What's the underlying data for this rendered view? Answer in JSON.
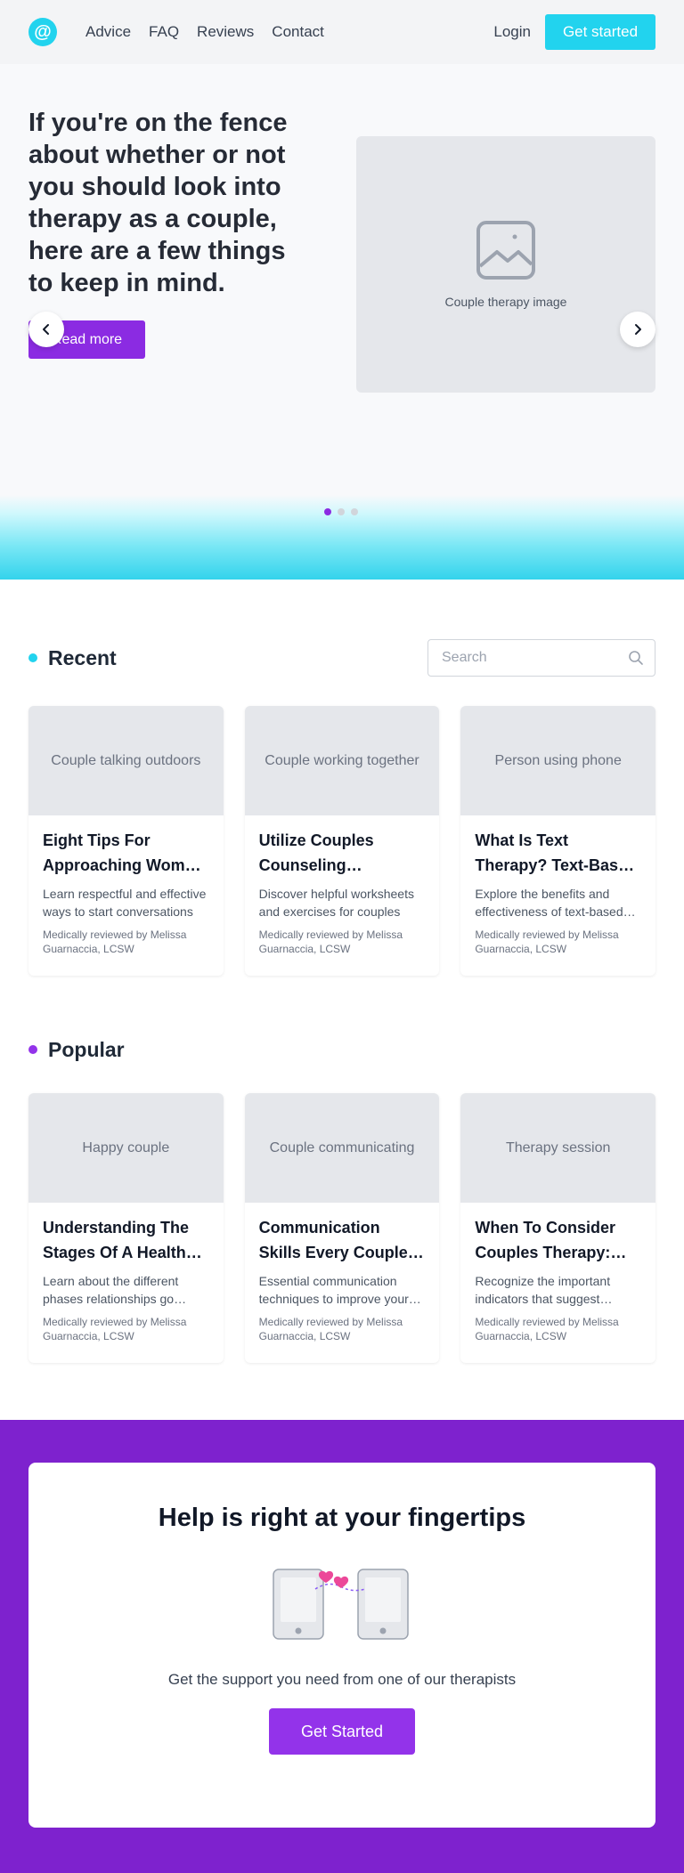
{
  "nav": {
    "logo_glyph": "@",
    "links": [
      "Advice",
      "FAQ",
      "Reviews",
      "Contact"
    ],
    "login_label": "Login",
    "cta_label": "Get started"
  },
  "hero": {
    "headline": "If you're on the fence about whether or not you should look into therapy as a couple, here are a few things to keep in mind.",
    "button_label": "Read more",
    "image_label": "Couple therapy image",
    "slides_total": 3,
    "active_slide": 1
  },
  "recent": {
    "title": "Recent",
    "accent": "#22d3ee",
    "search_placeholder": "Search",
    "cards": [
      {
        "image_label": "Couple talking outdoors",
        "title": "Eight Tips For Approaching Women Respectfully",
        "description": "Learn respectful and effective ways to start conversations",
        "reviewer": "Medically reviewed by Melissa Guarnaccia, LCSW"
      },
      {
        "image_label": "Couple working together",
        "title": "Utilize Couples Counseling Worksheets",
        "description": "Discover helpful worksheets and exercises for couples",
        "reviewer": "Medically reviewed by Melissa Guarnaccia, LCSW"
      },
      {
        "image_label": "Person using phone",
        "title": "What Is Text Therapy? Text-Based Counseling",
        "description": "Explore the benefits and effectiveness of text-based therapy",
        "reviewer": "Medically reviewed by Melissa Guarnaccia, LCSW"
      }
    ]
  },
  "popular": {
    "title": "Popular",
    "accent": "#9333ea",
    "cards": [
      {
        "image_label": "Happy couple",
        "title": "Understanding The Stages Of A Healthy Relationship",
        "description": "Learn about the different phases relationships go through",
        "reviewer": "Medically reviewed by Melissa Guarnaccia, LCSW"
      },
      {
        "image_label": "Couple communicating",
        "title": "Communication Skills Every Couple Needs",
        "description": "Essential communication techniques to improve your relationship",
        "reviewer": "Medically reviewed by Melissa Guarnaccia, LCSW"
      },
      {
        "image_label": "Therapy session",
        "title": "When To Consider Couples Therapy: Signs",
        "description": "Recognize the important indicators that suggest therapy",
        "reviewer": "Medically reviewed by Melissa Guarnaccia, LCSW"
      }
    ]
  },
  "cta": {
    "title": "Help is right at your fingertips",
    "subtitle": "Get the support you need from one of our therapists",
    "button_label": "Get Started"
  },
  "colors": {
    "cyan": "#22d3ee",
    "purple": "#8b2be2",
    "deep_purple": "#7e22ce",
    "heart": "#ec4899"
  }
}
